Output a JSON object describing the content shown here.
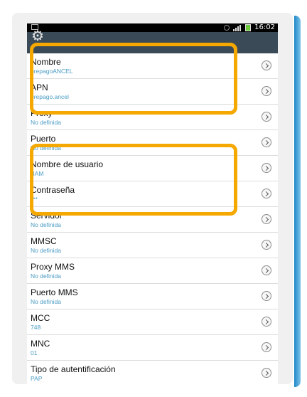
{
  "status_bar": {
    "time": "16:02"
  },
  "settings": [
    {
      "title": "Nombre",
      "value": "prepagoANCEL"
    },
    {
      "title": "APN",
      "value": "prepago.ancel"
    },
    {
      "title": "Proxy",
      "value": "No definida"
    },
    {
      "title": "Puerto",
      "value": "No definida"
    },
    {
      "title": "Nombre de usuario",
      "value": "BAM"
    },
    {
      "title": "Contraseña",
      "value": "***"
    },
    {
      "title": "Servidor",
      "value": "No definida"
    },
    {
      "title": "MMSC",
      "value": "No definida"
    },
    {
      "title": "Proxy MMS",
      "value": "No definida"
    },
    {
      "title": "Puerto MMS",
      "value": "No definida"
    },
    {
      "title": "MCC",
      "value": "748"
    },
    {
      "title": "MNC",
      "value": "01"
    },
    {
      "title": "Tipo de autentificación",
      "value": "PAP"
    }
  ],
  "highlight_color": "#f5a800",
  "subtitle_color": "#4a9bc4"
}
